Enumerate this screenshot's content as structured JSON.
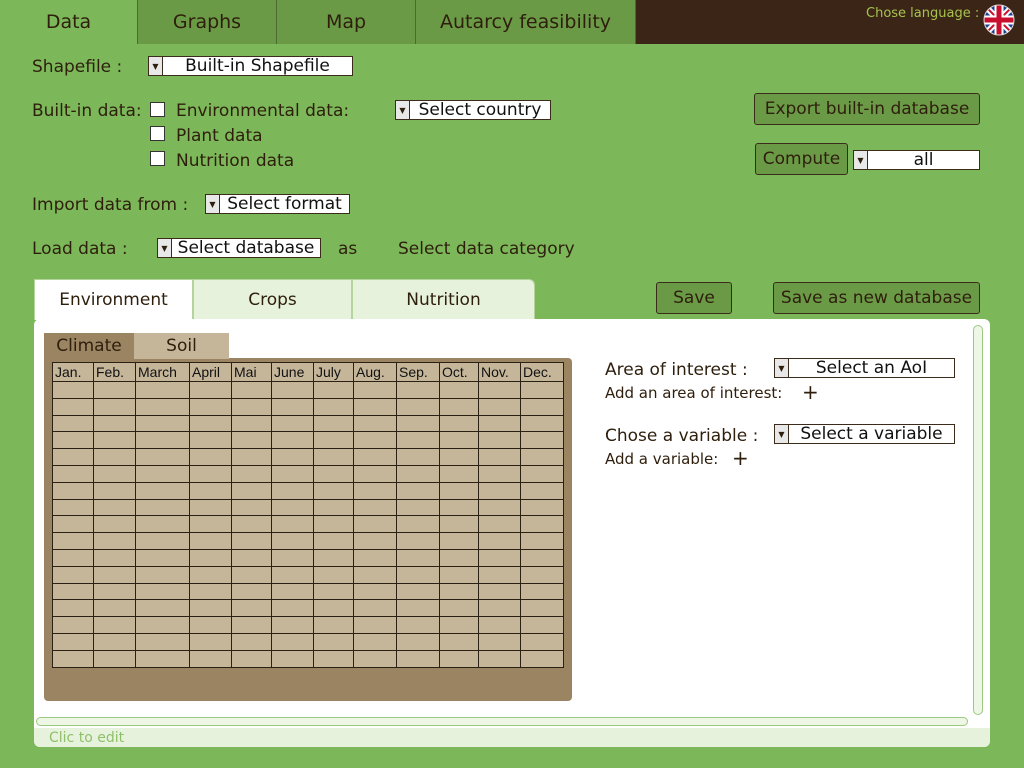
{
  "tabs": [
    "Data",
    "Graphs",
    "Map",
    "Autarcy feasibility"
  ],
  "language": {
    "label": "Chose language :",
    "icon": "uk-flag-icon"
  },
  "shapefile": {
    "label": "Shapefile :",
    "value": "Built-in Shapefile"
  },
  "builtin": {
    "label": "Built-in data:",
    "env_label": "Environmental data:",
    "plant_label": "Plant data",
    "nutrition_label": "Nutrition data",
    "country_value": "Select country"
  },
  "export_button": "Export built-in database",
  "compute": {
    "button": "Compute",
    "value": "all"
  },
  "import": {
    "label": "Import data from :",
    "value": "Select format"
  },
  "load": {
    "label": "Load data :",
    "value": "Select database",
    "as": "as",
    "category": "Select data category"
  },
  "panel_tabs": [
    "Environment",
    "Crops",
    "Nutrition"
  ],
  "save_button": "Save",
  "save_new_button": "Save as new database",
  "subtabs": [
    "Climate",
    "Soil"
  ],
  "months": [
    "Jan.",
    "Feb.",
    "March",
    "April",
    "Mai",
    "June",
    "July",
    "Aug.",
    "Sep.",
    "Oct.",
    "Nov.",
    "Dec."
  ],
  "aoi": {
    "label": "Area of interest :",
    "value": "Select an AoI",
    "add_label": "Add an area of interest:"
  },
  "variable": {
    "label": "Chose a variable :",
    "value": "Select a variable",
    "add_label": "Add a variable:"
  },
  "status": "Clic to edit",
  "colors": {
    "background": "#7cb85a",
    "topbar": "#3b2516",
    "table_bg": "#c5b69a",
    "table_frame": "#9a8462"
  }
}
